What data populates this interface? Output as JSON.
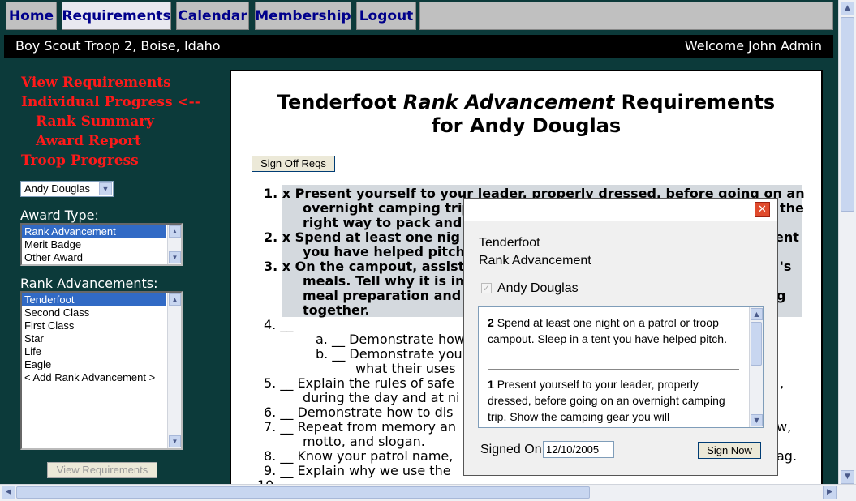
{
  "nav": {
    "tabs": [
      {
        "label": "Home"
      },
      {
        "label": "Requirements"
      },
      {
        "label": "Calendar"
      },
      {
        "label": "Membership"
      },
      {
        "label": "Logout"
      }
    ]
  },
  "header": {
    "site_title": "Boy Scout Troop 2, Boise, Idaho",
    "welcome": "Welcome John Admin"
  },
  "sidebar": {
    "links": [
      {
        "label": "View Requirements"
      },
      {
        "label": "Individual Progress <--"
      },
      {
        "label": "Rank Summary"
      },
      {
        "label": "Award Report"
      },
      {
        "label": "Troop Progress"
      }
    ],
    "member_select": "Andy Douglas",
    "award_type_label": "Award Type:",
    "award_types": [
      "Rank Advancement",
      "Merit Badge",
      "Other Award"
    ],
    "rank_label": "Rank Advancements:",
    "ranks": [
      "Tenderfoot",
      "Second Class",
      "First Class",
      "Star",
      "Life",
      "Eagle",
      "< Add Rank Advancement >"
    ],
    "view_button": "View Requirements"
  },
  "main": {
    "title_line1_a": "Tenderfoot ",
    "title_line1_b": "Rank Advancement",
    "title_line1_c": " Requirements",
    "title_line2": "for Andy Douglas",
    "signoff_button": "Sign Off Reqs",
    "requirements": [
      {
        "text": "1.  x  Present yourself to your leader, properly dressed, before going on an"
      },
      {
        "text": "overnight camping trip."
      },
      {
        "text": "the"
      },
      {
        "text": "right way to pack and c"
      },
      {
        "text": "2.  x  Spend at least one nig"
      },
      {
        "text": "ent"
      },
      {
        "text": "you have helped pitch."
      },
      {
        "text": "3.  x  On the campout, assist"
      },
      {
        "text": "'s"
      },
      {
        "text": "meals. Tell why it is imp"
      },
      {
        "text": "meal preparation and c"
      },
      {
        "text": "g"
      },
      {
        "text": "together."
      },
      {
        "text": "4. __"
      },
      {
        "text": "a.  __  Demonstrate how"
      },
      {
        "text": "b.  __  Demonstrate you"
      },
      {
        "text": "what their uses"
      },
      {
        "text": "5. __ Explain the rules of safe"
      },
      {
        "text": ","
      },
      {
        "text": "during the day and at ni"
      },
      {
        "text": "6. __ Demonstrate how to dis"
      },
      {
        "text": "7. __ Repeat from memory an"
      },
      {
        "text": "w,"
      },
      {
        "text": "motto, and slogan."
      },
      {
        "text": "8. __ Know your patrol name,"
      },
      {
        "text": "ag."
      },
      {
        "text": "9. __ Explain why we use the"
      },
      {
        "text": "10."
      }
    ]
  },
  "modal": {
    "heading1": "Tenderfoot",
    "heading2": "Rank Advancement",
    "member": "Andy Douglas",
    "items": [
      {
        "num": "2",
        "text": "Spend at least one night on a patrol or troop campout. Sleep in a tent you have helped pitch."
      },
      {
        "num": "1",
        "text": "Present yourself to your leader, properly dressed, before going on an overnight camping trip. Show the camping gear you will"
      }
    ],
    "signed_on_label": "Signed On",
    "signed_on_value": "12/10/2005",
    "sign_button": "Sign Now"
  }
}
